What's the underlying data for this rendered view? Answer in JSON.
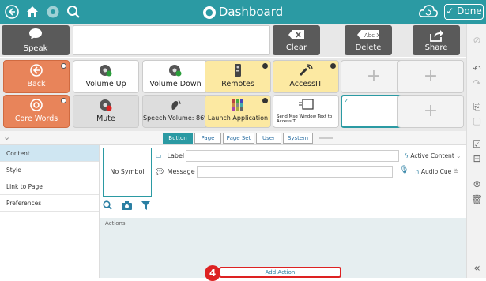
{
  "topbar": {
    "title": "Dashboard",
    "done_label": "Done",
    "icons": [
      "back-icon",
      "home-icon",
      "settings-icon",
      "search-icon",
      "cloud-icon"
    ]
  },
  "message": {
    "speak_label": "Speak",
    "clear_label": "Clear",
    "delete_label": "Delete",
    "share_label": "Share",
    "delete_icon_text": "Abc X"
  },
  "grid": {
    "row1": [
      {
        "label": "Back",
        "style": "orange",
        "icon": "back-arrow-icon"
      },
      {
        "label": "Volume Up",
        "style": "white",
        "icon": "volume-up-icon"
      },
      {
        "label": "Volume Down",
        "style": "white",
        "icon": "volume-down-icon"
      },
      {
        "label": "Remotes",
        "style": "yellow",
        "icon": "remote-icon"
      },
      {
        "label": "AccessIT",
        "style": "yellow",
        "icon": "wireless-icon"
      },
      {
        "label": "",
        "style": "empty"
      },
      {
        "label": "",
        "style": "empty"
      }
    ],
    "row2": [
      {
        "label": "Core Words",
        "style": "orange",
        "icon": "core-icon"
      },
      {
        "label": "Mute",
        "style": "white",
        "icon": "mute-icon"
      },
      {
        "label": "Speech Volume: 86%",
        "style": "white",
        "icon": "speech-volume-icon"
      },
      {
        "label": "Launch Application",
        "style": "yellow",
        "icon": "apps-icon"
      },
      {
        "label": "Send Msg Window Text to AccessIT",
        "style": "white",
        "icon": "send-msg-icon"
      },
      {
        "label": "",
        "style": "selected"
      },
      {
        "label": "",
        "style": "empty"
      }
    ]
  },
  "tabs": [
    "Button",
    "Page",
    "Page Set",
    "User",
    "System"
  ],
  "inspector": {
    "nav": [
      "Content",
      "Style",
      "Link to Page",
      "Preferences"
    ],
    "no_symbol": "No Symbol",
    "label_field": "Label",
    "message_field": "Message",
    "active_content": "Active Content",
    "audio_cue": "Audio Cue",
    "actions_label": "Actions",
    "add_action": "Add Action",
    "step_number": "4"
  },
  "colors": {
    "accent": "#2b9aa3",
    "orange": "#e8845a",
    "yellow": "#fce9a2",
    "highlight": "#dd2222"
  }
}
